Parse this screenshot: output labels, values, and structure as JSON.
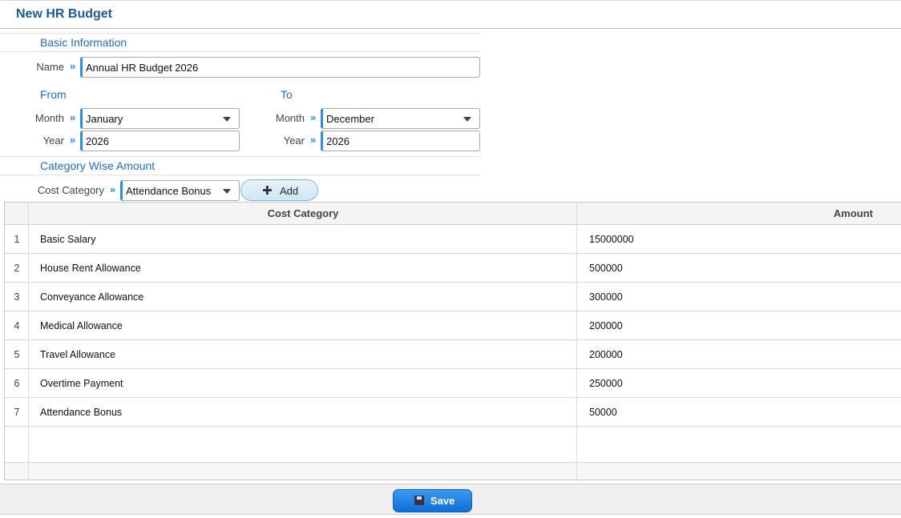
{
  "window": {
    "title": "New HR Budget"
  },
  "sections": {
    "basic_info": "Basic Information",
    "from": "From",
    "to": "To",
    "category_wise": "Category Wise Amount"
  },
  "form": {
    "name_label": "Name",
    "name_value": "Annual HR Budget 2026",
    "from_month_label": "Month",
    "from_month_value": "January",
    "from_year_label": "Year",
    "from_year_value": "2026",
    "to_month_label": "Month",
    "to_month_value": "December",
    "to_year_label": "Year",
    "to_year_value": "2026",
    "cost_category_label": "Cost Category",
    "cost_category_value": "Attendance Bonus",
    "add_label": "Add"
  },
  "table": {
    "headers": {
      "category": "Cost Category",
      "amount": "Amount"
    },
    "rows": [
      {
        "num": "1",
        "category": "Basic Salary",
        "amount": "15000000"
      },
      {
        "num": "2",
        "category": "House Rent Allowance",
        "amount": "500000"
      },
      {
        "num": "3",
        "category": "Conveyance Allowance",
        "amount": "300000"
      },
      {
        "num": "4",
        "category": "Medical Allowance",
        "amount": "200000"
      },
      {
        "num": "5",
        "category": "Travel Allowance",
        "amount": "200000"
      },
      {
        "num": "6",
        "category": "Overtime Payment",
        "amount": "250000"
      },
      {
        "num": "7",
        "category": "Attendance Bonus",
        "amount": "50000"
      }
    ]
  },
  "footer": {
    "save_label": "Save"
  },
  "colors": {
    "accent": "#2e8ee0",
    "title": "#1f5a96",
    "save": "#0d6fd6"
  }
}
